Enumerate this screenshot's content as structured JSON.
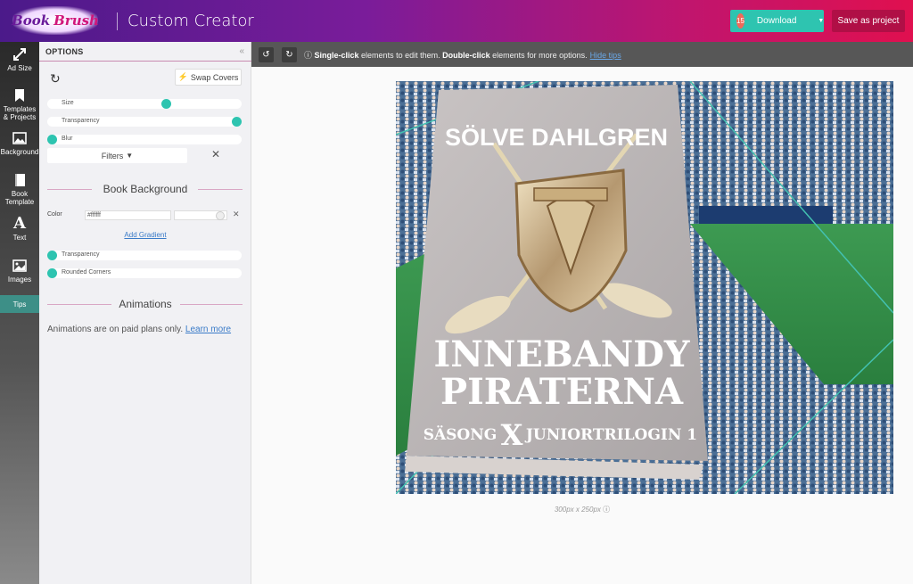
{
  "header": {
    "logo_text_1": "Book",
    "logo_text_2": "Brush",
    "title": "Custom Creator",
    "download_badge": "15",
    "download_label": "Download",
    "save_label": "Save as project"
  },
  "rail": {
    "items": [
      {
        "label": "Ad Size",
        "icon": "resize-arrows-icon"
      },
      {
        "label": "Templates & Projects",
        "icon": "bookmark-icon"
      },
      {
        "label": "Background",
        "icon": "image-icon"
      },
      {
        "label": "Book Template",
        "icon": "book-icon"
      },
      {
        "label": "Text",
        "icon": "text-icon"
      },
      {
        "label": "Images",
        "icon": "picture-icon"
      },
      {
        "label": "Tips",
        "icon": ""
      }
    ]
  },
  "options": {
    "title": "OPTIONS",
    "swap_label": "Swap Covers",
    "sliders": [
      {
        "label": "Size",
        "value": 0.55
      },
      {
        "label": "Transparency",
        "value": 1.0
      },
      {
        "label": "Blur",
        "value": 0.0
      }
    ],
    "filters_label": "Filters",
    "book_bg_title": "Book Background",
    "color_label": "Color",
    "color_value": "#ffffff",
    "add_gradient": "Add Gradient",
    "book_sliders": [
      {
        "label": "Transparency",
        "value": 0.0
      },
      {
        "label": "Rounded Corners",
        "value": 0.0
      }
    ],
    "animations_title": "Animations",
    "animations_text": "Animations are on paid plans only.",
    "learn_more": "Learn more"
  },
  "toolbar": {
    "single_click": "Single-click",
    "single_rest": " elements to edit them. ",
    "double_click": "Double-click",
    "double_rest": " elements for more options.",
    "hide_tips": "Hide tips"
  },
  "book": {
    "author": "SÖLVE DAHLGREN",
    "title_line1": "INNEBANDY",
    "title_line2": "PIRATERNA",
    "subtitle_left": "SÄSONG",
    "subtitle_mid": "X",
    "subtitle_right": "JUNIORTRILOGIN 1"
  },
  "canvas": {
    "size_note": "300px x 250px"
  },
  "colors": {
    "accent": "#2ec4b0",
    "save": "#b00f46",
    "link": "#3a7bc8"
  }
}
